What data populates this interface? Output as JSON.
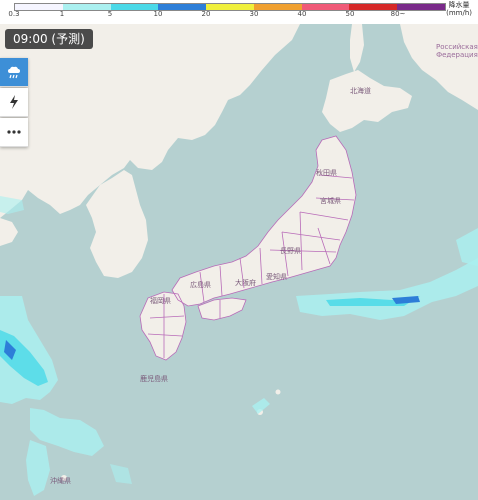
{
  "legend": {
    "ticks": [
      "0.3",
      "1",
      "5",
      "10",
      "20",
      "30",
      "40",
      "50",
      "80~"
    ],
    "unit_title": "降水量",
    "unit": "(mm/h)",
    "colors": [
      "#f5f5ff",
      "#aaf0f0",
      "#4ad9e8",
      "#2d7ed8",
      "#f0f03c",
      "#f0a030",
      "#f05a78",
      "#d62828",
      "#7a2a8a"
    ]
  },
  "time_badge": "09:00 (予測)",
  "controls": [
    {
      "name": "rain-layer-button",
      "icon": "rain-cloud-icon",
      "active": true
    },
    {
      "name": "lightning-layer-button",
      "icon": "lightning-icon",
      "active": false
    },
    {
      "name": "more-button",
      "icon": "more-dots-icon",
      "active": false
    }
  ],
  "labels": {
    "hokkaido": "北海道",
    "akita": "秋田県",
    "miyagi": "宮城県",
    "nagano": "長野県",
    "aichi": "愛知県",
    "osaka": "大阪府",
    "hiroshima": "広島県",
    "fukuoka": "福岡県",
    "kagoshima": "鹿児島県",
    "okinawa": "沖縄県",
    "russia_ru": "Российская",
    "russia_ru2": "Федерация"
  },
  "colors": {
    "sea": "#b5d0d0",
    "land": "#f2efe9",
    "border": "#b86bb8",
    "rain_light": "#aaf0f0",
    "rain_mid": "#4ad9e8",
    "rain_heavy": "#2d7ed8"
  }
}
